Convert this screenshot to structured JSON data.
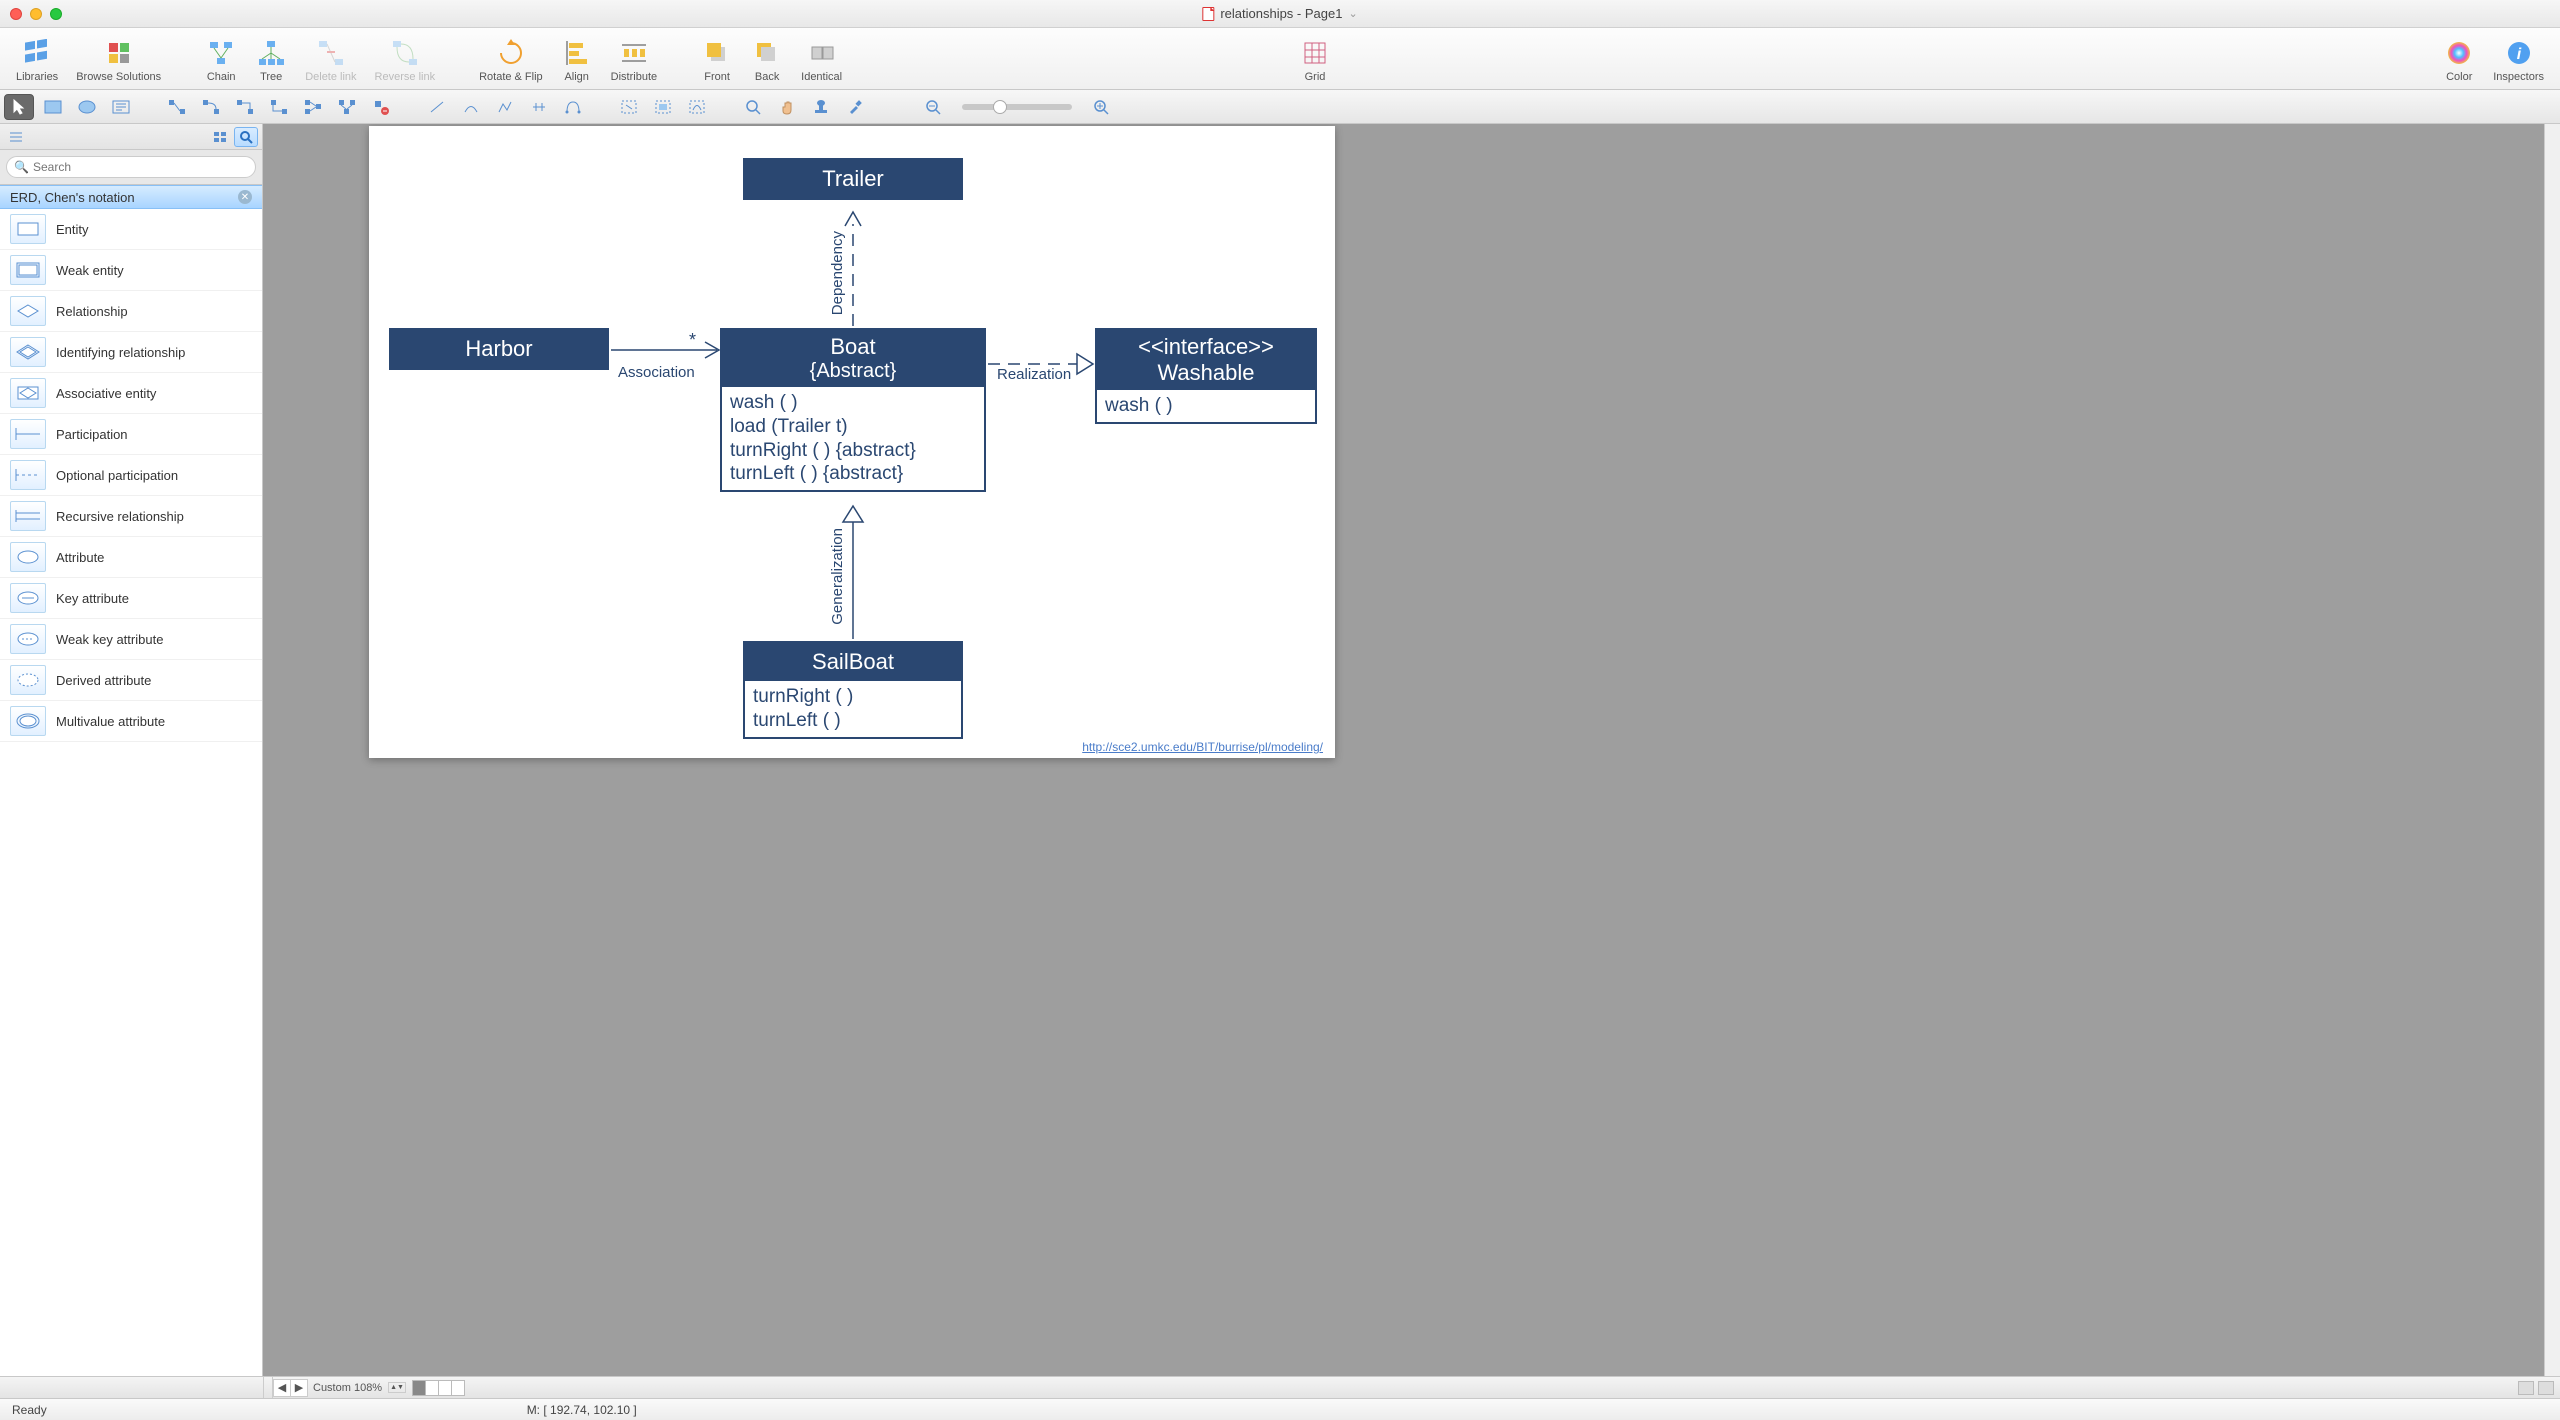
{
  "window": {
    "title": "relationships - Page1"
  },
  "toolbar": {
    "libraries": "Libraries",
    "browse": "Browse Solutions",
    "chain": "Chain",
    "tree": "Tree",
    "delete_link": "Delete link",
    "reverse_link": "Reverse link",
    "rotate_flip": "Rotate & Flip",
    "align": "Align",
    "distribute": "Distribute",
    "front": "Front",
    "back": "Back",
    "identical": "Identical",
    "grid": "Grid",
    "color": "Color",
    "inspectors": "Inspectors"
  },
  "sidebar": {
    "search_placeholder": "Search",
    "section_title": "ERD, Chen's notation",
    "items": [
      {
        "label": "Entity"
      },
      {
        "label": "Weak entity"
      },
      {
        "label": "Relationship"
      },
      {
        "label": "Identifying relationship"
      },
      {
        "label": "Associative entity"
      },
      {
        "label": "Participation"
      },
      {
        "label": "Optional participation"
      },
      {
        "label": "Recursive relationship"
      },
      {
        "label": "Attribute"
      },
      {
        "label": "Key attribute"
      },
      {
        "label": "Weak key attribute"
      },
      {
        "label": "Derived attribute"
      },
      {
        "label": "Multivalue attribute"
      }
    ]
  },
  "diagram": {
    "trailer": {
      "title": "Trailer"
    },
    "harbor": {
      "title": "Harbor"
    },
    "boat": {
      "title": "Boat",
      "subtitle": "{Abstract}",
      "ops": [
        "wash ( )",
        "load (Trailer t)",
        "turnRight ( ) {abstract}",
        "turnLeft ( ) {abstract}"
      ]
    },
    "washable": {
      "title1": "<<interface>>",
      "title2": "Washable",
      "ops": [
        "wash ( )"
      ]
    },
    "sailboat": {
      "title": "SailBoat",
      "ops": [
        "turnRight ( )",
        "turnLeft ( )"
      ]
    },
    "labels": {
      "dependency": "Dependency",
      "association": "Association",
      "star": "*",
      "realization": "Realization",
      "generalization": "Generalization"
    },
    "link": "http://sce2.umkc.edu/BIT/burrise/pl/modeling/"
  },
  "tabstrip": {
    "zoom_label": "Custom 108%"
  },
  "status": {
    "ready": "Ready",
    "mouse": "M: [ 192.74, 102.10 ]"
  }
}
